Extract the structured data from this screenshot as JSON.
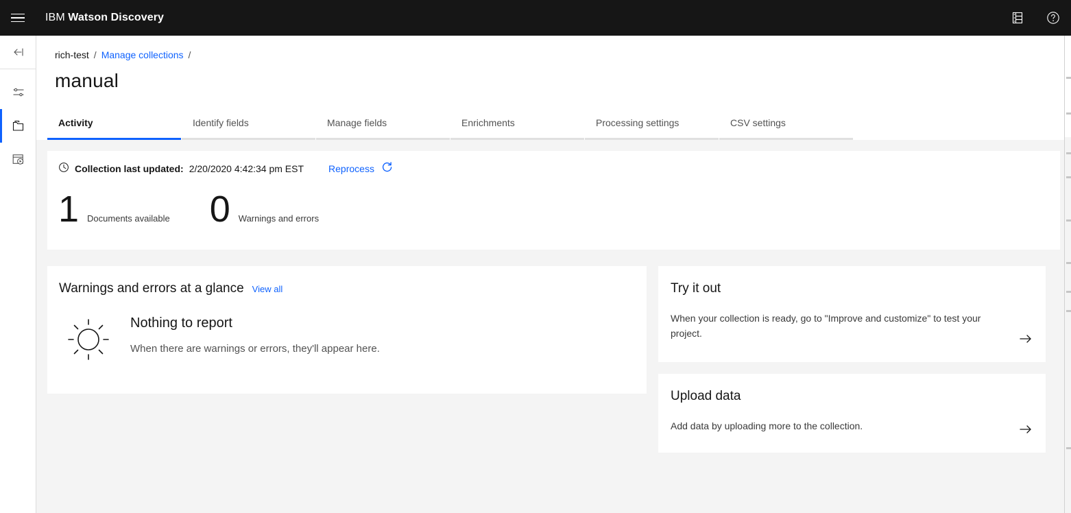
{
  "header": {
    "menu_icon": "hamburger-menu-icon",
    "brand_prefix": "IBM",
    "brand_name": "Watson Discovery",
    "icons": [
      {
        "name": "data-list-icon",
        "label": "Data"
      },
      {
        "name": "help-icon",
        "label": "Help"
      }
    ]
  },
  "rail": {
    "items": [
      {
        "name": "collapse-rail-icon",
        "label": "Collapse",
        "active": false
      },
      {
        "name": "settings-sliders-icon",
        "label": "Project settings",
        "active": false
      },
      {
        "name": "folder-collections-icon",
        "label": "Manage collections",
        "active": true
      },
      {
        "name": "document-play-icon",
        "label": "Improve and customize",
        "active": false
      }
    ]
  },
  "breadcrumb": {
    "project": "rich-test",
    "link": "Manage collections",
    "separator": "/"
  },
  "page": {
    "title": "manual"
  },
  "tabs": [
    {
      "label": "Activity",
      "active": true
    },
    {
      "label": "Identify fields",
      "active": false
    },
    {
      "label": "Manage fields",
      "active": false
    },
    {
      "label": "Enrichments",
      "active": false
    },
    {
      "label": "Processing settings",
      "active": false
    },
    {
      "label": "CSV settings",
      "active": false
    }
  ],
  "status_panel": {
    "clock_icon": "clock-icon",
    "updated_label": "Collection last updated:",
    "updated_value": "2/20/2020 4:42:34 pm EST",
    "reprocess_label": "Reprocess",
    "reprocess_icon": "restart-refresh-icon",
    "stats": [
      {
        "value": "1",
        "caption": "Documents available"
      },
      {
        "value": "0",
        "caption": "Warnings and errors"
      }
    ]
  },
  "warnings_panel": {
    "title": "Warnings and errors at a glance",
    "view_all": "View all",
    "empty_icon": "sun-icon",
    "empty_title": "Nothing to report",
    "empty_description": "When there are warnings or errors, they'll appear here."
  },
  "cards": [
    {
      "title": "Try it out",
      "description": "When your collection is ready, go to \"Improve and customize\" to test your project.",
      "arrow_icon": "arrow-right-icon"
    },
    {
      "title": "Upload data",
      "description": "Add data by uploading more to the collection.",
      "arrow_icon": "arrow-right-icon"
    }
  ],
  "colors": {
    "header_bg": "#161616",
    "accent_blue": "#0f62fe",
    "page_bg": "#f4f4f4",
    "panel_bg": "#ffffff",
    "text_primary": "#161616",
    "text_secondary": "#525252",
    "tab_underline": "#e0e0e0"
  }
}
